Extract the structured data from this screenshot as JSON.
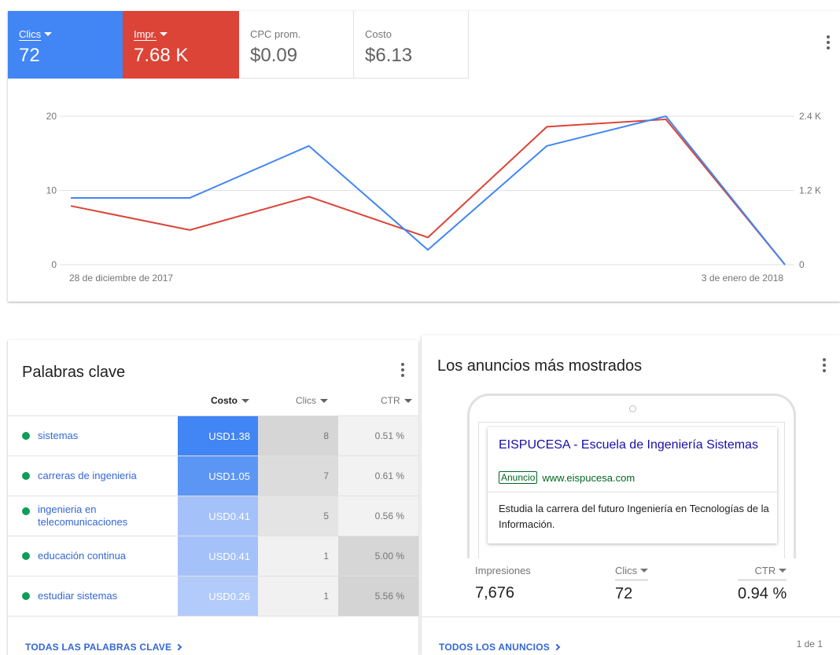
{
  "overview": {
    "metrics": [
      {
        "label": "Clics",
        "value": "72",
        "color": "#4285f4"
      },
      {
        "label": "Impr.",
        "value": "7.68 K",
        "color": "#db4437"
      },
      {
        "label": "CPC prom.",
        "value": "$0.09"
      },
      {
        "label": "Costo",
        "value": "$6.13"
      }
    ],
    "chart": {
      "left_ticks": [
        "20",
        "10",
        "0"
      ],
      "right_ticks": [
        "2.4 K",
        "1.2 K",
        "0"
      ],
      "start_label": "28 de diciembre de 2017",
      "end_label": "3 de enero de 2018"
    }
  },
  "chart_data": {
    "type": "line",
    "x": [
      "2017-12-28",
      "2017-12-29",
      "2017-12-30",
      "2017-12-31",
      "2018-01-01",
      "2018-01-02",
      "2018-01-03"
    ],
    "series": [
      {
        "name": "Clics",
        "axis": "left",
        "color": "#4285f4",
        "values": [
          9,
          9,
          16,
          2,
          16,
          20,
          0
        ]
      },
      {
        "name": "Impr.",
        "axis": "right",
        "color": "#db4437",
        "values": [
          950,
          560,
          1100,
          440,
          2230,
          2350,
          0
        ]
      }
    ],
    "ylim_left": [
      0,
      20
    ],
    "ylim_right": [
      0,
      2400
    ],
    "grid": true
  },
  "keywords": {
    "title": "Palabras clave",
    "headers": {
      "cost": "Costo",
      "clicks": "Clics",
      "ctr": "CTR"
    },
    "rows": [
      {
        "name": "sistemas",
        "cost": "USD1.38",
        "clicks": "8",
        "ctr": "0.51 %",
        "cost_bg": "#4285f4",
        "clicks_bg": "#d6d6d6",
        "ctr_bg": "#f2f2f2"
      },
      {
        "name": "carreras de ingenieria",
        "cost": "USD1.05",
        "clicks": "7",
        "ctr": "0.61 %",
        "cost_bg": "#5c96f5",
        "clicks_bg": "#dcdcdc",
        "ctr_bg": "#f2f2f2"
      },
      {
        "name": "ingenieria en telecomunicaciones",
        "cost": "USD0.41",
        "clicks": "5",
        "ctr": "0.56 %",
        "cost_bg": "#a4c2f9",
        "clicks_bg": "#e4e4e4",
        "ctr_bg": "#f2f2f2"
      },
      {
        "name": "educación continua",
        "cost": "USD0.41",
        "clicks": "1",
        "ctr": "5.00 %",
        "cost_bg": "#a4c2f9",
        "clicks_bg": "#f1f1f1",
        "ctr_bg": "#d6d6d6"
      },
      {
        "name": "estudiar sistemas",
        "cost": "USD0.26",
        "clicks": "1",
        "ctr": "5.56 %",
        "cost_bg": "#b2cbfa",
        "clicks_bg": "#f1f1f1",
        "ctr_bg": "#d4d4d4"
      }
    ],
    "footer_link": "TODAS LAS PALABRAS CLAVE"
  },
  "ads": {
    "title": "Los anuncios más mostrados",
    "ad": {
      "headline": "EISPUCESA - Escuela de Ingeniería Sistemas",
      "badge": "Anuncio",
      "url": "www.eispucesa.com",
      "description": "Estudia la carrera del futuro Ingeniería en Tecnologías de la Información."
    },
    "stats": [
      {
        "label": "Impresiones",
        "value": "7,676"
      },
      {
        "label": "Clics",
        "value": "72"
      },
      {
        "label": "CTR",
        "value": "0.94 %"
      }
    ],
    "footer_link": "TODOS LOS ANUNCIOS",
    "pager": "1 de 1"
  },
  "icons": [
    "more-vert-icon",
    "caret-down-icon",
    "chevron-right-icon",
    "status-dot-icon"
  ]
}
